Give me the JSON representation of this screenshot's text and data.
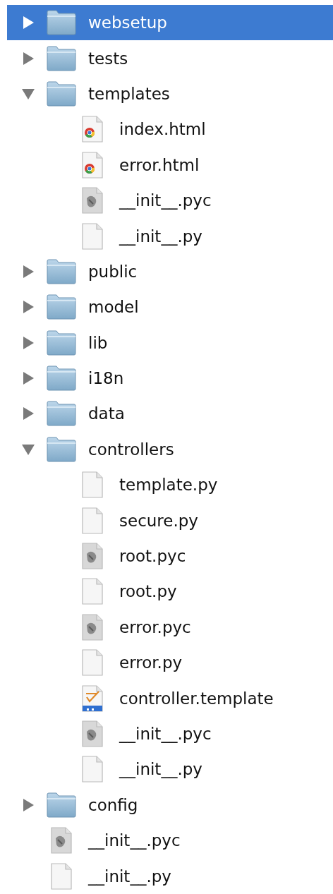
{
  "tree": [
    {
      "kind": "folder",
      "name": "websetup",
      "expanded": false,
      "selected": true
    },
    {
      "kind": "folder",
      "name": "tests",
      "expanded": false,
      "selected": false
    },
    {
      "kind": "folder",
      "name": "templates",
      "expanded": true,
      "selected": false,
      "children": [
        {
          "kind": "html-file",
          "name": "index.html",
          "selected": false
        },
        {
          "kind": "html-file",
          "name": "error.html",
          "selected": false
        },
        {
          "kind": "compiled-file",
          "name": "__init__.pyc",
          "selected": false
        },
        {
          "kind": "text-file",
          "name": "__init__.py",
          "selected": false
        }
      ]
    },
    {
      "kind": "folder",
      "name": "public",
      "expanded": false,
      "selected": false
    },
    {
      "kind": "folder",
      "name": "model",
      "expanded": false,
      "selected": false
    },
    {
      "kind": "folder",
      "name": "lib",
      "expanded": false,
      "selected": false
    },
    {
      "kind": "folder",
      "name": "i18n",
      "expanded": false,
      "selected": false
    },
    {
      "kind": "folder",
      "name": "data",
      "expanded": false,
      "selected": false
    },
    {
      "kind": "folder",
      "name": "controllers",
      "expanded": true,
      "selected": false,
      "children": [
        {
          "kind": "text-file",
          "name": "template.py",
          "selected": false
        },
        {
          "kind": "text-file",
          "name": "secure.py",
          "selected": false
        },
        {
          "kind": "compiled-file",
          "name": "root.pyc",
          "selected": false
        },
        {
          "kind": "text-file",
          "name": "root.py",
          "selected": false
        },
        {
          "kind": "compiled-file",
          "name": "error.pyc",
          "selected": false
        },
        {
          "kind": "text-file",
          "name": "error.py",
          "selected": false
        },
        {
          "kind": "template-file",
          "name": "controller.template",
          "selected": false
        },
        {
          "kind": "compiled-file",
          "name": "__init__.pyc",
          "selected": false
        },
        {
          "kind": "text-file",
          "name": "__init__.py",
          "selected": false
        }
      ]
    },
    {
      "kind": "folder",
      "name": "config",
      "expanded": false,
      "selected": false
    },
    {
      "kind": "compiled-file",
      "name": "__init__.pyc",
      "selected": false
    },
    {
      "kind": "text-file",
      "name": "__init__.py",
      "selected": false
    }
  ]
}
